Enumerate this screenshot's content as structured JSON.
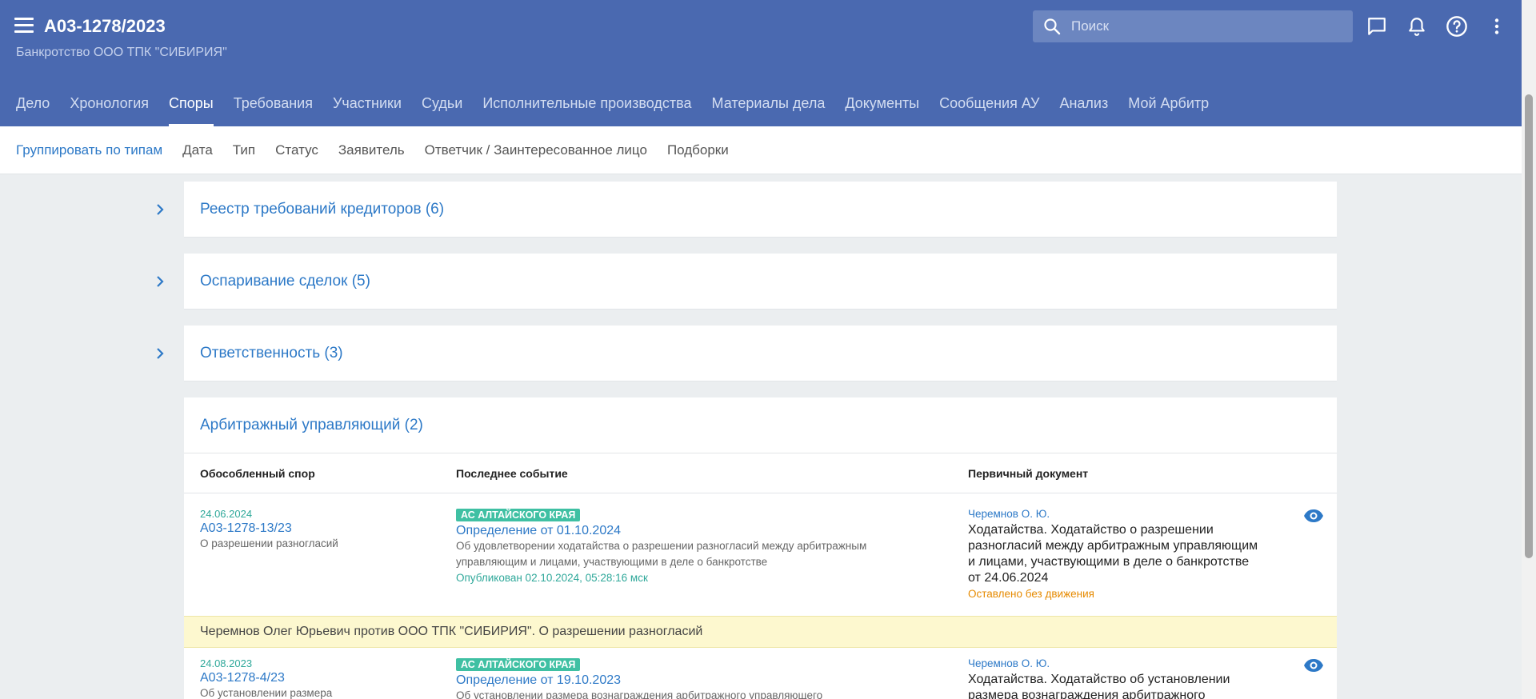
{
  "header": {
    "case_number": "А03-1278/2023",
    "case_subtitle": "Банкротство ООО ТПК \"СИБИРИЯ\"",
    "search_placeholder": "Поиск",
    "icons": [
      "menu-icon",
      "search-icon",
      "chat-icon",
      "bell-icon",
      "help-icon",
      "more-vert-icon"
    ]
  },
  "tabs": [
    {
      "label": "Дело"
    },
    {
      "label": "Хронология"
    },
    {
      "label": "Споры",
      "active": true
    },
    {
      "label": "Требования"
    },
    {
      "label": "Участники"
    },
    {
      "label": "Судьи"
    },
    {
      "label": "Исполнительные производства"
    },
    {
      "label": "Материалы дела"
    },
    {
      "label": "Документы"
    },
    {
      "label": "Сообщения АУ"
    },
    {
      "label": "Анализ"
    },
    {
      "label": "Мой Арбитр"
    }
  ],
  "subnav": [
    {
      "label": "Группировать по типам",
      "active": true
    },
    {
      "label": "Дата"
    },
    {
      "label": "Тип"
    },
    {
      "label": "Статус"
    },
    {
      "label": "Заявитель"
    },
    {
      "label": "Ответчик / Заинтересованное лицо"
    },
    {
      "label": "Подборки"
    }
  ],
  "groups": [
    {
      "title": "Реестр требований кредиторов (6)",
      "expanded": false
    },
    {
      "title": "Оспаривание сделок (5)",
      "expanded": false
    },
    {
      "title": "Ответственность (3)",
      "expanded": false
    },
    {
      "title": "Арбитражный управляющий (2)",
      "expanded": true
    }
  ],
  "table": {
    "columns": [
      "Обособленный спор",
      "Последнее событие",
      "Первичный документ"
    ],
    "rows": [
      {
        "date": "24.06.2024",
        "case_number": "А03-1278-13/23",
        "subject": "О разрешении разногласий",
        "court": "АС АЛТАЙСКОГО КРАЯ",
        "event_title": "Определение от 01.10.2024",
        "event_desc_line1": "Об удовлетворении ходатайства о разрешении разногласий между арбитражным",
        "event_desc_line2": "управляющим и лицами, участвующими в деле о банкротстве",
        "published": "Опубликован 02.10.2024, 05:28:16 мск",
        "doc_author": "Черемнов О. Ю.",
        "doc_line1": "Ходатайства. Ходатайство о разрешении",
        "doc_line2": "разногласий между арбитражным управляющим",
        "doc_line3": "и лицами, участвующими в деле о банкротстве",
        "doc_line4": "от 24.06.2024",
        "doc_status": "Оставлено без движения"
      },
      {
        "date": "24.08.2023",
        "case_number": "А03-1278-4/23",
        "subject": "Об установлении размера",
        "court": "АС АЛТАЙСКОГО КРАЯ",
        "event_title": "Определение от 19.10.2023",
        "event_desc_line1": "Об установлении размера вознаграждения арбитражного управляющего",
        "doc_author": "Черемнов О. Ю.",
        "doc_line1": "Ходатайства. Ходатайство об установлении",
        "doc_line2": "размера вознаграждения арбитражного"
      }
    ],
    "banner": "Черемнов Олег Юрьевич против ООО ТПК \"СИБИРИЯ\". О разрешении разногласий"
  },
  "colors": {
    "header_bg": "#4a69b0",
    "link": "#2d79c7",
    "green": "#2fa89a",
    "badge": "#3fc0a3",
    "warning": "#e68a00",
    "banner_bg": "#fdf8cf"
  }
}
